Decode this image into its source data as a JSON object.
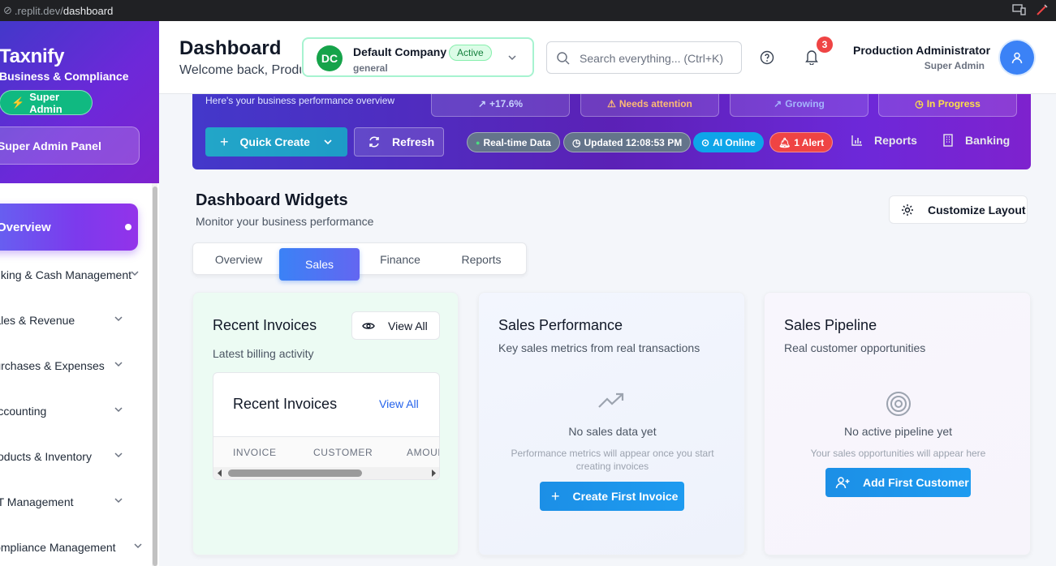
{
  "browser": {
    "url_prefix": ".replit.dev/",
    "url_path": "dashboard"
  },
  "sidebar": {
    "brand": "Taxnify",
    "tagline": "Business & Compliance",
    "role_badge": "Super Admin",
    "panel_button": "Super Admin Panel",
    "active_item": "Overview",
    "items": [
      {
        "label": "Banking & Cash Management"
      },
      {
        "label": "Sales & Revenue"
      },
      {
        "label": "Purchases & Expenses"
      },
      {
        "label": "Accounting"
      },
      {
        "label": "Products & Inventory"
      },
      {
        "label": "VAT Management"
      },
      {
        "label": "Compliance Management"
      }
    ]
  },
  "header": {
    "title": "Dashboard",
    "welcome": "Welcome back, Production Administrator",
    "company": {
      "initials": "DC",
      "name": "Default Company",
      "type": "general",
      "status": "Active"
    },
    "search_placeholder": "Search everything... (Ctrl+K)",
    "notification_count": "3",
    "user": {
      "name": "Production Administrator",
      "role": "Super Admin"
    }
  },
  "banner": {
    "subtitle": "Here's your business performance overview",
    "stats": [
      {
        "label": "+17.6%",
        "color": "#c7d2fe"
      },
      {
        "label": "Needs attention",
        "color": "#fdba74"
      },
      {
        "label": "Growing",
        "color": "#a5b4fc"
      },
      {
        "label": "In Progress",
        "color": "#fde047"
      }
    ],
    "quick_create": "Quick Create",
    "refresh": "Refresh",
    "pills": [
      {
        "label": "Real-time Data",
        "color": "#64748b"
      },
      {
        "label": "Updated 12:08:53 PM",
        "color": "#64748b"
      },
      {
        "label": "AI Online",
        "color": "#0ea5e9"
      },
      {
        "label": "1 Alert",
        "color": "#ef4444"
      }
    ],
    "links": [
      "Reports",
      "Banking"
    ]
  },
  "widgets": {
    "title": "Dashboard Widgets",
    "subtitle": "Monitor your business performance",
    "customize": "Customize Layout",
    "tabs": [
      "Overview",
      "Sales",
      "Finance",
      "Reports"
    ],
    "active_tab": "Sales"
  },
  "cards": {
    "invoices": {
      "title": "Recent Invoices",
      "subtitle": "Latest billing activity",
      "view_all": "View All",
      "inner_title": "Recent Invoices",
      "inner_link": "View All",
      "columns": [
        "INVOICE",
        "CUSTOMER",
        "AMOUNT"
      ]
    },
    "performance": {
      "title": "Sales Performance",
      "subtitle": "Key sales metrics from real transactions",
      "empty_title": "No sales data yet",
      "empty_sub": "Performance metrics will appear once you start creating invoices",
      "cta": "Create First Invoice"
    },
    "pipeline": {
      "title": "Sales Pipeline",
      "subtitle": "Real customer opportunities",
      "empty_title": "No active pipeline yet",
      "empty_sub": "Your sales opportunities will appear here",
      "cta": "Add First Customer"
    }
  },
  "colors": {
    "accent": "#6d28d9",
    "primary": "#3b82f6",
    "success": "#16a34a",
    "cta": "#1d9bf0"
  }
}
